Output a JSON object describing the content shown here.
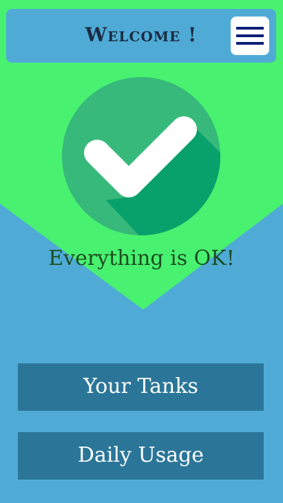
{
  "header": {
    "title": "Welcome !",
    "menu_icon": "hamburger-menu-icon"
  },
  "status": {
    "icon": "checkmark-circle-icon",
    "message": "Everything is OK!"
  },
  "buttons": {
    "tanks_label": "Your Tanks",
    "usage_label": "Daily Usage"
  },
  "colors": {
    "background_blue": "#4fabd6",
    "banner_green": "#48f170",
    "circle_green": "#36b97a",
    "shadow_green": "#08a06b",
    "button_blue": "#2b7698",
    "title_dark": "#1a2c43",
    "status_text_green": "#1c4d1f",
    "menu_lines": "#0c1f78"
  }
}
